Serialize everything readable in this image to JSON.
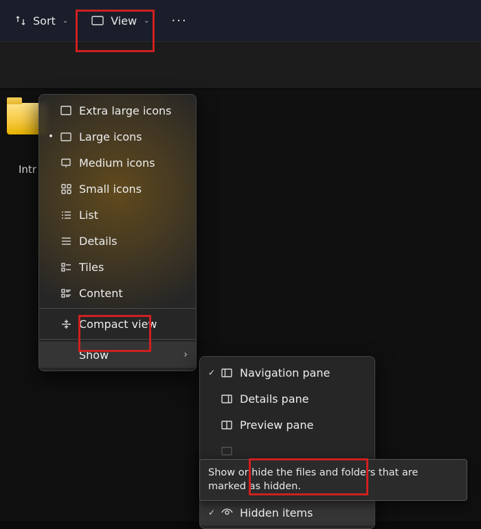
{
  "toolbar": {
    "sort_label": "Sort",
    "view_label": "View",
    "more_label": "···"
  },
  "folder_label": "Intr",
  "view_menu": {
    "items": [
      {
        "label": "Extra large icons"
      },
      {
        "label": "Large icons",
        "selected": true
      },
      {
        "label": "Medium icons"
      },
      {
        "label": "Small icons"
      },
      {
        "label": "List"
      },
      {
        "label": "Details"
      },
      {
        "label": "Tiles"
      },
      {
        "label": "Content"
      }
    ],
    "compact_label": "Compact view",
    "show_label": "Show"
  },
  "show_menu": {
    "nav_label": "Navigation pane",
    "details_label": "Details pane",
    "preview_label": "Preview pane",
    "hidden_label": "Hidden items"
  },
  "tooltip_text": "Show or hide the files and folders that are marked as hidden."
}
